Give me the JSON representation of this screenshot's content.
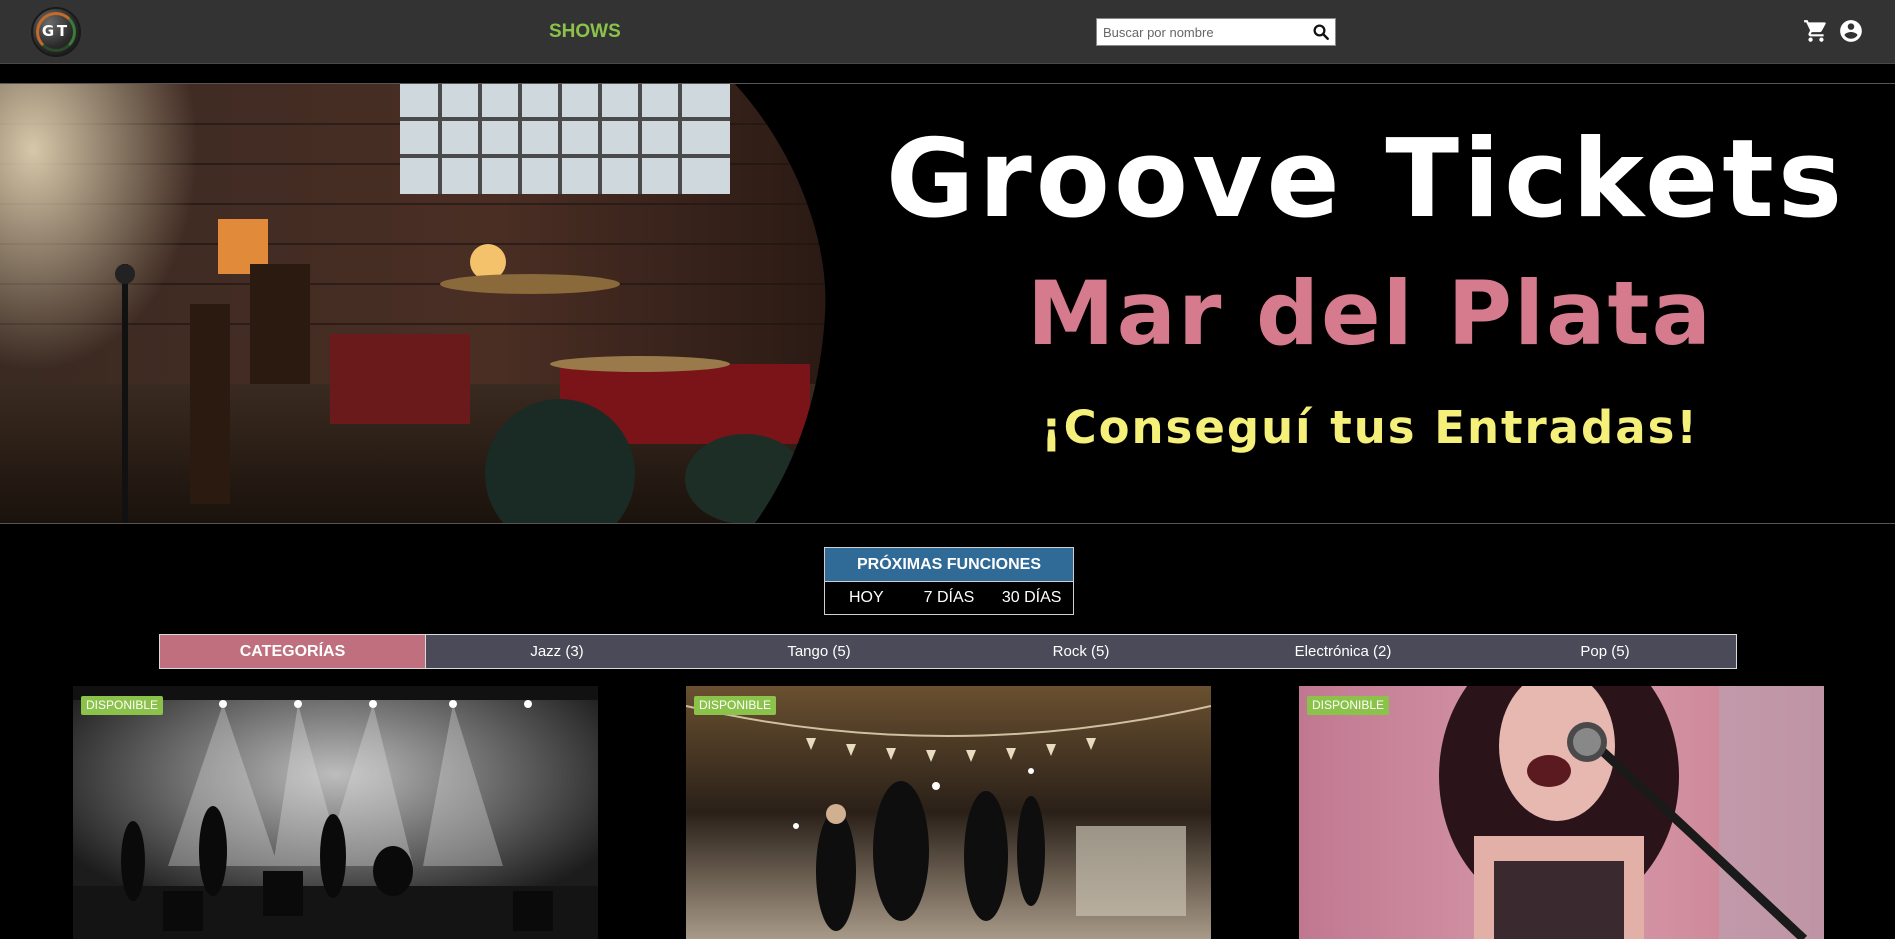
{
  "navbar": {
    "logo_text": "GT",
    "nav_link": "SHOWS",
    "search_placeholder": "Buscar por nombre",
    "search_icon": "search-icon",
    "cart_icon": "cart-icon",
    "account_icon": "account-circle-icon",
    "accent_color": "#8bc34a"
  },
  "hero": {
    "title": "Groove Tickets",
    "subtitle": "Mar del Plata",
    "tagline": "¡Conseguí tus Entradas!",
    "title_color": "#ffffff",
    "subtitle_color": "#d67a8e",
    "tagline_color": "#f4f07a"
  },
  "funciones": {
    "title": "PRÓXIMAS FUNCIONES",
    "options": [
      "HOY",
      "7 DÍAS",
      "30 DÍAS"
    ],
    "header_color": "#2f6b96"
  },
  "categories": {
    "title": "CATEGORÍAS",
    "items": [
      "Jazz (3)",
      "Tango (5)",
      "Rock (5)",
      "Electrónica (2)",
      "Pop (5)"
    ],
    "header_color": "#bf6f7e"
  },
  "cards": [
    {
      "badge": "DISPONIBLE"
    },
    {
      "badge": "DISPONIBLE"
    },
    {
      "badge": "DISPONIBLE"
    }
  ],
  "badge_color": "#8bc34a"
}
